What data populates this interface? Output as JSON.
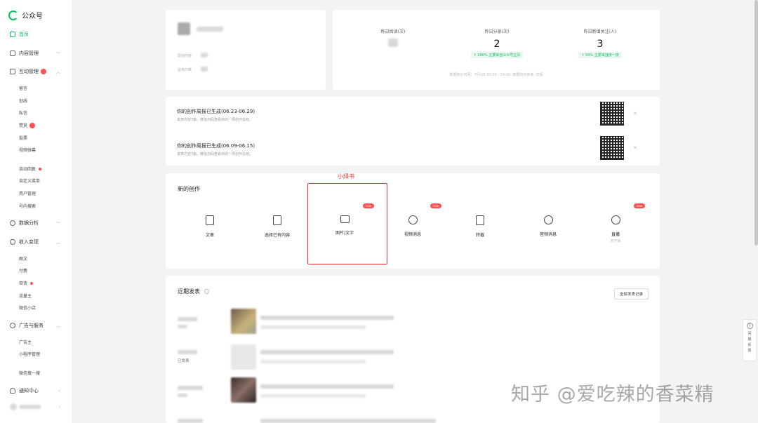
{
  "app": {
    "title": "公众号",
    "brand_color": "#07c160"
  },
  "sidebar": {
    "home": "首页",
    "content_mgmt": "内容管理",
    "interaction": "互动管理",
    "interaction_subs": [
      "留言",
      "划线",
      "私信",
      "赞赏",
      "投票",
      "视频弹幕"
    ],
    "auto_reply": "自动回复",
    "custom_menu": "自定义菜单",
    "user_mgmt": "用户管理",
    "search": "号内搜索",
    "data_analysis": "数据分析",
    "monetization": "收入变现",
    "monetization_subs": [
      "图文",
      "付费",
      "带货",
      "流量主",
      "微信小店"
    ],
    "ads": "广告与服务",
    "ads_subs": [
      "广告主",
      "小程序管理"
    ],
    "wechat_search": "微信搜一搜",
    "notifications": "通知中心"
  },
  "profile": {
    "original_label": "原创内容",
    "total_users_label": "总用户数"
  },
  "stats": {
    "items": [
      {
        "label": "昨日阅读(次)",
        "value": ""
      },
      {
        "label": "昨日分享(次)",
        "value": "2",
        "change": "↑ 200%  主要来自公众号主页"
      },
      {
        "label": "昨日新增关注(人)",
        "value": "3",
        "change": "↑ 50%  主要来自搜一搜"
      }
    ],
    "note": "数据统计时间：7月2日 00:00 - 24:00, 数据仅供参考, 详情"
  },
  "notices": [
    {
      "title": "你的创作周报已生成(06.23-06.29)",
      "desc": "发表内容7篇，微信扫码查看你的一周创作总结。"
    },
    {
      "title": "你的创作周报已生成(06.09-06.15)",
      "desc": "发表内容7篇，微信扫码查看你的一周创作总结。"
    }
  ],
  "create": {
    "title": "新的创作",
    "highlight_label": "小绿书",
    "new_tag": "new",
    "tools": [
      {
        "label": "文章",
        "icon": "article-icon"
      },
      {
        "label": "选择已有内容",
        "icon": "existing-content-icon"
      },
      {
        "label": "图片/文字",
        "icon": "image-text-icon"
      },
      {
        "label": "视频消息",
        "icon": "video-icon"
      },
      {
        "label": "转载",
        "icon": "repost-icon"
      },
      {
        "label": "音频消息",
        "icon": "audio-icon"
      },
      {
        "label": "直播",
        "icon": "live-icon",
        "sub": "未开启"
      }
    ]
  },
  "recent": {
    "title": "近期发表",
    "all_button": "全部发表记录",
    "rows": [
      {
        "status": ""
      },
      {
        "status": "已发表"
      },
      {
        "status": ""
      }
    ]
  },
  "help": {
    "chars": [
      "问",
      "题",
      "反",
      "馈"
    ]
  },
  "watermark": "知乎 @爱吃辣的香菜精"
}
